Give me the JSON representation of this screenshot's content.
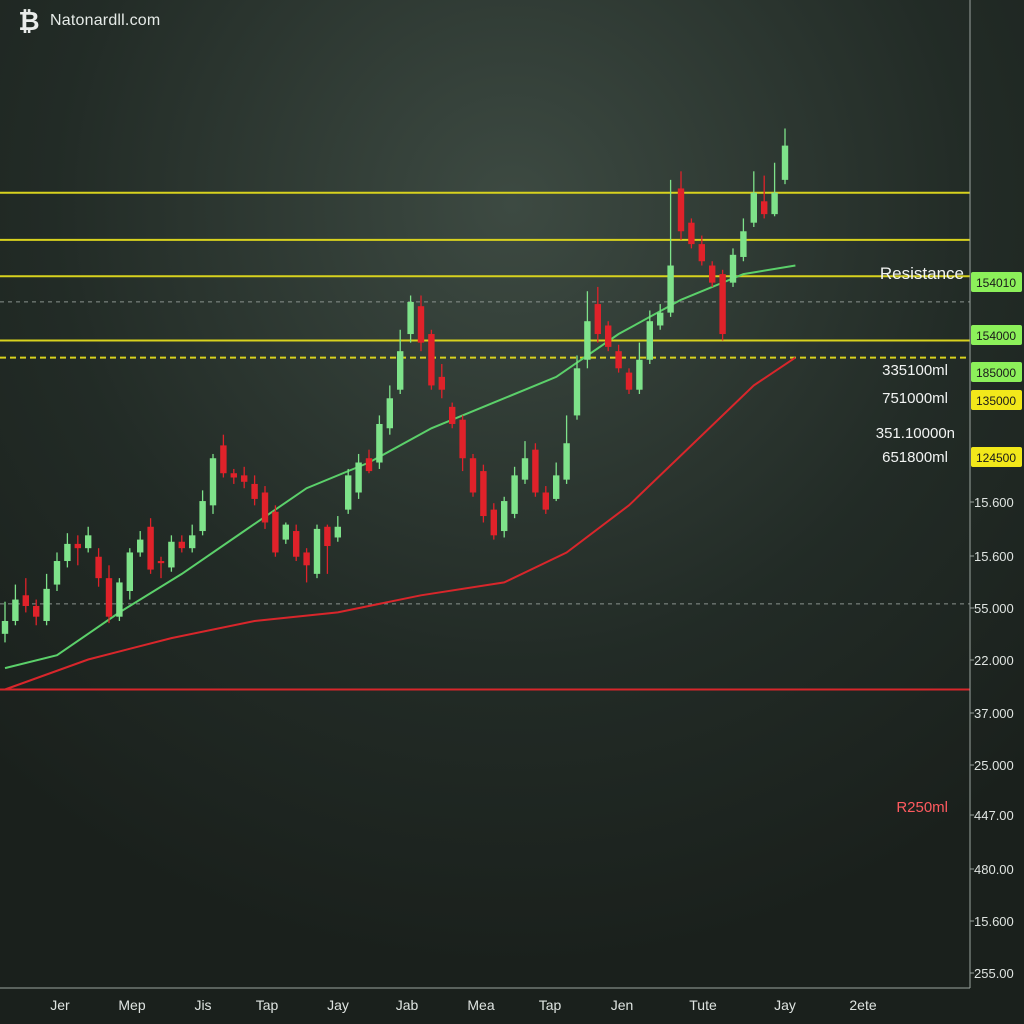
{
  "site": {
    "name": "Natonardll.com",
    "logo_icon": "bitcoin-icon"
  },
  "colors": {
    "background": "#1e2622",
    "bull": "#7ee28a",
    "bear": "#e0222a",
    "level": "#d8d21e",
    "fast_ma": "#5bd06a",
    "slow_ma": "#d8262b",
    "axis_text": "#dfe4e1",
    "label_green": "#8cf05a",
    "label_yellow": "#f2e81a"
  },
  "chart_data": {
    "type": "candlestick",
    "x_tick_labels": [
      "Jer",
      "Mep",
      "Jis",
      "Tap",
      "Jay",
      "Jab",
      "Mea",
      "Tap",
      "Jen",
      "Tute",
      "Jay",
      "2ete"
    ],
    "y_tick_labels": [
      "15.600",
      "15.600",
      "55.000",
      "22.000",
      "37.000",
      "25.000",
      "447.00",
      "480.00",
      "15.600",
      "255.00"
    ],
    "price_tags": [
      {
        "text": "154010",
        "style": "green"
      },
      {
        "text": "154000",
        "style": "green"
      },
      {
        "text": "185000",
        "style": "green"
      },
      {
        "text": "135000",
        "style": "yellow"
      },
      {
        "text": "124500",
        "style": "yellow"
      }
    ],
    "level_labels": [
      "Resistance",
      "335100ml",
      "751000ml",
      "351.10000n",
      "651800ml",
      "R250ml"
    ],
    "levels": [
      {
        "style": "yellow-solid",
        "price": 1850
      },
      {
        "style": "yellow-solid",
        "price": 1740
      },
      {
        "style": "yellow-solid",
        "price": 1655
      },
      {
        "style": "gray-dashed",
        "price": 1595
      },
      {
        "style": "yellow-solid",
        "price": 1505
      },
      {
        "style": "yellow-dashed",
        "price": 1465
      },
      {
        "style": "gray-dashed",
        "price": 890
      },
      {
        "style": "red-solid",
        "price": 690
      }
    ],
    "y_range": [
      0,
      2300
    ],
    "grid": false,
    "candles": [
      [
        820,
        850,
        895,
        800
      ],
      [
        850,
        900,
        935,
        840
      ],
      [
        910,
        885,
        950,
        870
      ],
      [
        885,
        860,
        900,
        840
      ],
      [
        850,
        925,
        960,
        840
      ],
      [
        935,
        990,
        1010,
        920
      ],
      [
        990,
        1030,
        1055,
        975
      ],
      [
        1030,
        1020,
        1050,
        980
      ],
      [
        1020,
        1050,
        1070,
        1010
      ],
      [
        1000,
        950,
        1020,
        930
      ],
      [
        950,
        860,
        980,
        845
      ],
      [
        860,
        940,
        950,
        850
      ],
      [
        920,
        1010,
        1020,
        900
      ],
      [
        1010,
        1040,
        1060,
        1000
      ],
      [
        1070,
        970,
        1090,
        960
      ],
      [
        990,
        985,
        1000,
        950
      ],
      [
        975,
        1035,
        1050,
        965
      ],
      [
        1035,
        1020,
        1050,
        1010
      ],
      [
        1020,
        1050,
        1075,
        1010
      ],
      [
        1060,
        1130,
        1155,
        1050
      ],
      [
        1120,
        1230,
        1240,
        1100
      ],
      [
        1260,
        1195,
        1285,
        1185
      ],
      [
        1195,
        1185,
        1205,
        1170
      ],
      [
        1190,
        1175,
        1210,
        1160
      ],
      [
        1170,
        1135,
        1190,
        1120
      ],
      [
        1150,
        1080,
        1165,
        1065
      ],
      [
        1105,
        1010,
        1120,
        1000
      ],
      [
        1040,
        1075,
        1080,
        1030
      ],
      [
        1060,
        1000,
        1075,
        990
      ],
      [
        1010,
        980,
        1020,
        940
      ],
      [
        960,
        1065,
        1075,
        950
      ],
      [
        1070,
        1025,
        1075,
        960
      ],
      [
        1045,
        1070,
        1095,
        1035
      ],
      [
        1110,
        1190,
        1205,
        1100
      ],
      [
        1150,
        1220,
        1240,
        1135
      ],
      [
        1230,
        1200,
        1250,
        1195
      ],
      [
        1220,
        1310,
        1330,
        1205
      ],
      [
        1300,
        1370,
        1400,
        1285
      ],
      [
        1390,
        1480,
        1530,
        1380
      ],
      [
        1520,
        1595,
        1610,
        1500
      ],
      [
        1585,
        1500,
        1610,
        1480
      ],
      [
        1520,
        1400,
        1530,
        1390
      ],
      [
        1420,
        1390,
        1450,
        1370
      ],
      [
        1350,
        1310,
        1360,
        1300
      ],
      [
        1320,
        1230,
        1330,
        1200
      ],
      [
        1230,
        1150,
        1240,
        1140
      ],
      [
        1200,
        1095,
        1215,
        1080
      ],
      [
        1110,
        1050,
        1125,
        1040
      ],
      [
        1060,
        1130,
        1140,
        1045
      ],
      [
        1100,
        1190,
        1210,
        1090
      ],
      [
        1180,
        1230,
        1270,
        1170
      ],
      [
        1250,
        1150,
        1265,
        1140
      ],
      [
        1150,
        1110,
        1165,
        1100
      ],
      [
        1135,
        1190,
        1220,
        1130
      ],
      [
        1180,
        1265,
        1330,
        1170
      ],
      [
        1330,
        1440,
        1470,
        1320
      ],
      [
        1460,
        1550,
        1620,
        1440
      ],
      [
        1590,
        1520,
        1630,
        1500
      ],
      [
        1540,
        1490,
        1550,
        1480
      ],
      [
        1480,
        1440,
        1495,
        1430
      ],
      [
        1430,
        1390,
        1440,
        1380
      ],
      [
        1390,
        1460,
        1500,
        1380
      ],
      [
        1460,
        1550,
        1575,
        1450
      ],
      [
        1540,
        1570,
        1590,
        1530
      ],
      [
        1570,
        1680,
        1880,
        1560
      ],
      [
        1860,
        1760,
        1900,
        1740
      ],
      [
        1780,
        1730,
        1790,
        1720
      ],
      [
        1730,
        1690,
        1750,
        1680
      ],
      [
        1680,
        1640,
        1690,
        1630
      ],
      [
        1660,
        1520,
        1670,
        1505
      ],
      [
        1640,
        1705,
        1720,
        1630
      ],
      [
        1700,
        1760,
        1790,
        1690
      ],
      [
        1780,
        1850,
        1900,
        1770
      ],
      [
        1830,
        1800,
        1890,
        1790
      ],
      [
        1800,
        1850,
        1920,
        1795
      ],
      [
        1880,
        1960,
        2000,
        1870
      ]
    ],
    "fast_ma": [
      [
        0,
        740
      ],
      [
        5,
        770
      ],
      [
        11,
        870
      ],
      [
        17,
        960
      ],
      [
        23,
        1060
      ],
      [
        29,
        1160
      ],
      [
        35,
        1220
      ],
      [
        41,
        1300
      ],
      [
        47,
        1360
      ],
      [
        53,
        1420
      ],
      [
        59,
        1520
      ],
      [
        65,
        1600
      ],
      [
        71,
        1660
      ],
      [
        76,
        1680
      ]
    ],
    "slow_ma": [
      [
        0,
        690
      ],
      [
        8,
        760
      ],
      [
        16,
        810
      ],
      [
        24,
        850
      ],
      [
        32,
        870
      ],
      [
        40,
        910
      ],
      [
        48,
        940
      ],
      [
        54,
        1010
      ],
      [
        60,
        1120
      ],
      [
        66,
        1260
      ],
      [
        72,
        1400
      ],
      [
        76,
        1465
      ]
    ]
  }
}
